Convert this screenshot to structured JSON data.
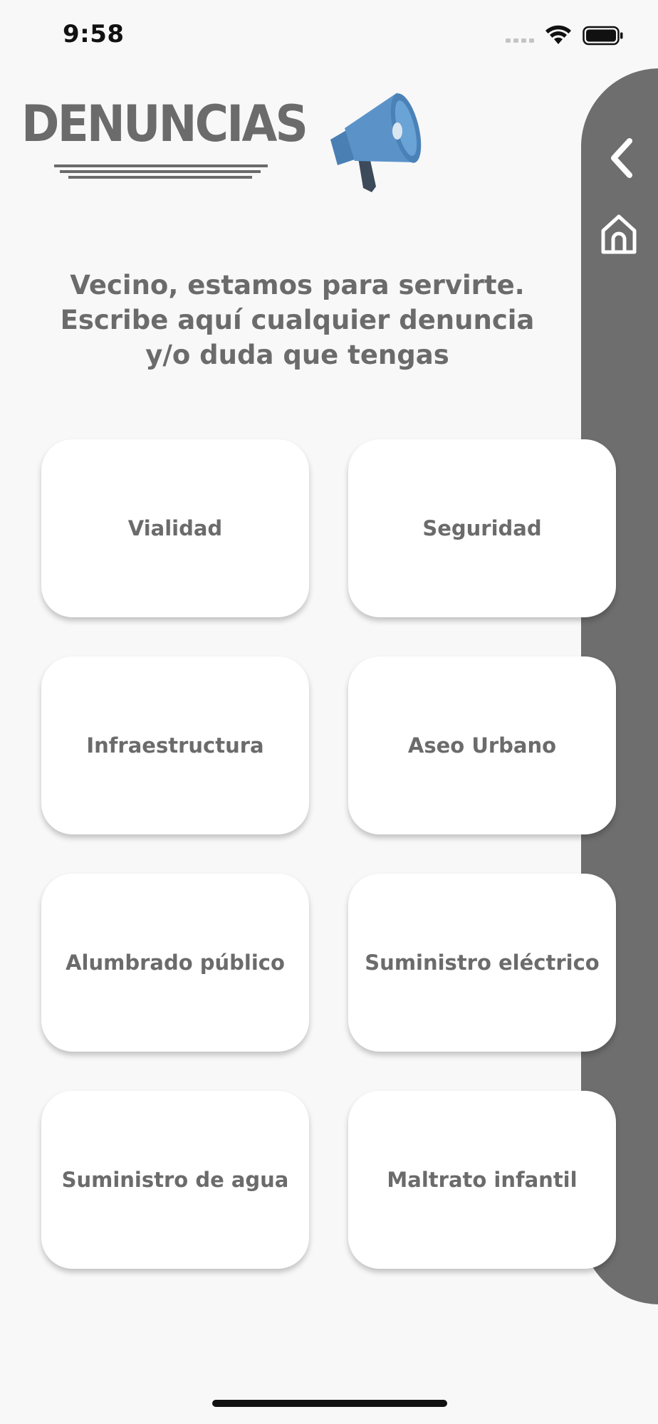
{
  "status_bar": {
    "time": "9:58",
    "signal_icon": "signal-bars-icon",
    "wifi_icon": "wifi-icon",
    "battery_icon": "battery-full-icon"
  },
  "side_panel": {
    "back_icon": "chevron-left-icon",
    "home_icon": "home-icon",
    "color": "#6e6e6e"
  },
  "header": {
    "title": "DENUNCIAS",
    "icon": "megaphone-icon",
    "icon_color": "#5b93c9"
  },
  "intro": {
    "text": "Vecino, estamos para servirte. Escribe aquí cualquier denuncia y/o duda que tengas"
  },
  "categories": [
    {
      "label": "Vialidad"
    },
    {
      "label": "Seguridad"
    },
    {
      "label": "Infraestructura"
    },
    {
      "label": "Aseo Urbano"
    },
    {
      "label": "Alumbrado público"
    },
    {
      "label": "Suministro eléctrico"
    },
    {
      "label": "Suministro de agua"
    },
    {
      "label": "Maltrato infantil"
    }
  ],
  "colors": {
    "background": "#f8f8f8",
    "text": "#6b6b6b",
    "card": "#ffffff"
  }
}
